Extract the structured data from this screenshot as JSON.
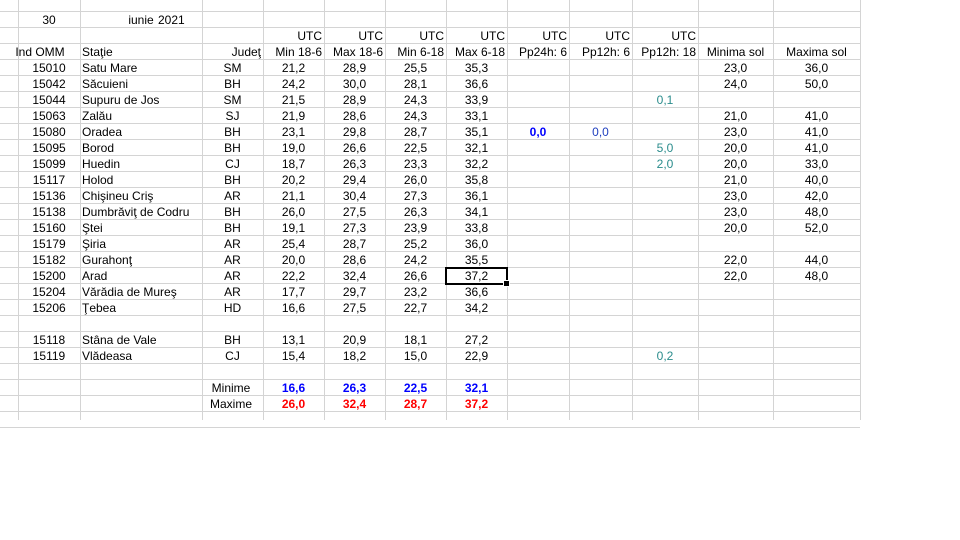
{
  "date": {
    "day": "30",
    "month": "iunie",
    "year": "2021"
  },
  "headers_top": [
    "UTC",
    "UTC",
    "UTC",
    "UTC",
    "UTC",
    "UTC",
    "UTC"
  ],
  "headers": [
    "Ind OMM",
    "Staţie",
    "Judeţ",
    "Min 18-6",
    "Max 18-6",
    "Min 6-18",
    "Max 6-18",
    "Pp24h: 6",
    "Pp12h: 6",
    "Pp12h: 18",
    "Minima sol",
    "Maxima sol"
  ],
  "rows": [
    {
      "id": "15010",
      "station": "Satu Mare",
      "county": "SM",
      "min186": "21,2",
      "max186": "28,9",
      "min618": "25,5",
      "max618": "35,3",
      "pp24": "",
      "pp12_6": "",
      "pp12_18": "",
      "minsol": "23,0",
      "maxsol": "36,0"
    },
    {
      "id": "15042",
      "station": "Săcuieni",
      "county": "BH",
      "min186": "24,2",
      "max186": "30,0",
      "min618": "28,1",
      "max618": "36,6",
      "pp24": "",
      "pp12_6": "",
      "pp12_18": "",
      "minsol": "24,0",
      "maxsol": "50,0"
    },
    {
      "id": "15044",
      "station": "Supuru de Jos",
      "county": "SM",
      "min186": "21,5",
      "max186": "28,9",
      "min618": "24,3",
      "max618": "33,9",
      "pp24": "",
      "pp12_6": "",
      "pp12_18": "0,1",
      "minsol": "",
      "maxsol": ""
    },
    {
      "id": "15063",
      "station": "Zalău",
      "county": "SJ",
      "min186": "21,9",
      "max186": "28,6",
      "min618": "24,3",
      "max618": "33,1",
      "pp24": "",
      "pp12_6": "",
      "pp12_18": "",
      "minsol": "21,0",
      "maxsol": "41,0"
    },
    {
      "id": "15080",
      "station": "Oradea",
      "county": "BH",
      "min186": "23,1",
      "max186": "29,8",
      "min618": "28,7",
      "max618": "35,1",
      "pp24": "0,0",
      "pp12_6": "0,0",
      "pp12_18": "",
      "minsol": "23,0",
      "maxsol": "41,0"
    },
    {
      "id": "15095",
      "station": "Borod",
      "county": "BH",
      "min186": "19,0",
      "max186": "26,6",
      "min618": "22,5",
      "max618": "32,1",
      "pp24": "",
      "pp12_6": "",
      "pp12_18": "5,0",
      "minsol": "20,0",
      "maxsol": "41,0"
    },
    {
      "id": "15099",
      "station": "Huedin",
      "county": "CJ",
      "min186": "18,7",
      "max186": "26,3",
      "min618": "23,3",
      "max618": "32,2",
      "pp24": "",
      "pp12_6": "",
      "pp12_18": "2,0",
      "minsol": "20,0",
      "maxsol": "33,0"
    },
    {
      "id": "15117",
      "station": "Holod",
      "county": "BH",
      "min186": "20,2",
      "max186": "29,4",
      "min618": "26,0",
      "max618": "35,8",
      "pp24": "",
      "pp12_6": "",
      "pp12_18": "",
      "minsol": "21,0",
      "maxsol": "40,0"
    },
    {
      "id": "15136",
      "station": "Chişineu   Criş",
      "county": "AR",
      "min186": "21,1",
      "max186": "30,4",
      "min618": "27,3",
      "max618": "36,1",
      "pp24": "",
      "pp12_6": "",
      "pp12_18": "",
      "minsol": "23,0",
      "maxsol": "42,0"
    },
    {
      "id": "15138",
      "station": "Dumbrăviţ  de Codru",
      "county": "BH",
      "min186": "26,0",
      "max186": "27,5",
      "min618": "26,3",
      "max618": "34,1",
      "pp24": "",
      "pp12_6": "",
      "pp12_18": "",
      "minsol": "23,0",
      "maxsol": "48,0"
    },
    {
      "id": "15160",
      "station": "Ştei",
      "county": "BH",
      "min186": "19,1",
      "max186": "27,3",
      "min618": "23,9",
      "max618": "33,8",
      "pp24": "",
      "pp12_6": "",
      "pp12_18": "",
      "minsol": "20,0",
      "maxsol": "52,0"
    },
    {
      "id": "15179",
      "station": "Şiria",
      "county": "AR",
      "min186": "25,4",
      "max186": "28,7",
      "min618": "25,2",
      "max618": "36,0",
      "pp24": "",
      "pp12_6": "",
      "pp12_18": "",
      "minsol": "",
      "maxsol": ""
    },
    {
      "id": "15182",
      "station": "Gurahonţ",
      "county": "AR",
      "min186": "20,0",
      "max186": "28,6",
      "min618": "24,2",
      "max618": "35,5",
      "pp24": "",
      "pp12_6": "",
      "pp12_18": "",
      "minsol": "22,0",
      "maxsol": "44,0"
    },
    {
      "id": "15200",
      "station": "Arad",
      "county": "AR",
      "min186": "22,2",
      "max186": "32,4",
      "min618": "26,6",
      "max618": "37,2",
      "pp24": "",
      "pp12_6": "",
      "pp12_18": "",
      "minsol": "22,0",
      "maxsol": "48,0"
    },
    {
      "id": "15204",
      "station": "Vărădia de Mureş",
      "county": "AR",
      "min186": "17,7",
      "max186": "29,7",
      "min618": "23,2",
      "max618": "36,6",
      "pp24": "",
      "pp12_6": "",
      "pp12_18": "",
      "minsol": "",
      "maxsol": ""
    },
    {
      "id": "15206",
      "station": "Ţebea",
      "county": "HD",
      "min186": "16,6",
      "max186": "27,5",
      "min618": "22,7",
      "max618": "34,2",
      "pp24": "",
      "pp12_6": "",
      "pp12_18": "",
      "minsol": "",
      "maxsol": ""
    },
    {
      "id": "",
      "station": "",
      "county": "",
      "min186": "",
      "max186": "",
      "min618": "",
      "max618": "",
      "pp24": "",
      "pp12_6": "",
      "pp12_18": "",
      "minsol": "",
      "maxsol": ""
    },
    {
      "id": "15118",
      "station": "Stâna de Vale",
      "county": "BH",
      "min186": "13,1",
      "max186": "20,9",
      "min618": "18,1",
      "max618": "27,2",
      "pp24": "",
      "pp12_6": "",
      "pp12_18": "",
      "minsol": "",
      "maxsol": ""
    },
    {
      "id": "15119",
      "station": "Vlădeasa",
      "county": "CJ",
      "min186": "15,4",
      "max186": "18,2",
      "min618": "15,0",
      "max618": "22,9",
      "pp24": "",
      "pp12_6": "",
      "pp12_18": "0,2",
      "minsol": "",
      "maxsol": ""
    }
  ],
  "summary": {
    "min_label": "Minime",
    "max_label": "Maxime",
    "minime": [
      "16,6",
      "26,3",
      "22,5",
      "32,1"
    ],
    "maxime": [
      "26,0",
      "32,4",
      "28,7",
      "37,2"
    ]
  },
  "colors": {
    "min_values": "#0000ff",
    "max_values": "#ff0000",
    "precip_blue": "#1f3fbf",
    "precip_teal": "#2a8c8c",
    "gridline": "#d4d4d4"
  }
}
